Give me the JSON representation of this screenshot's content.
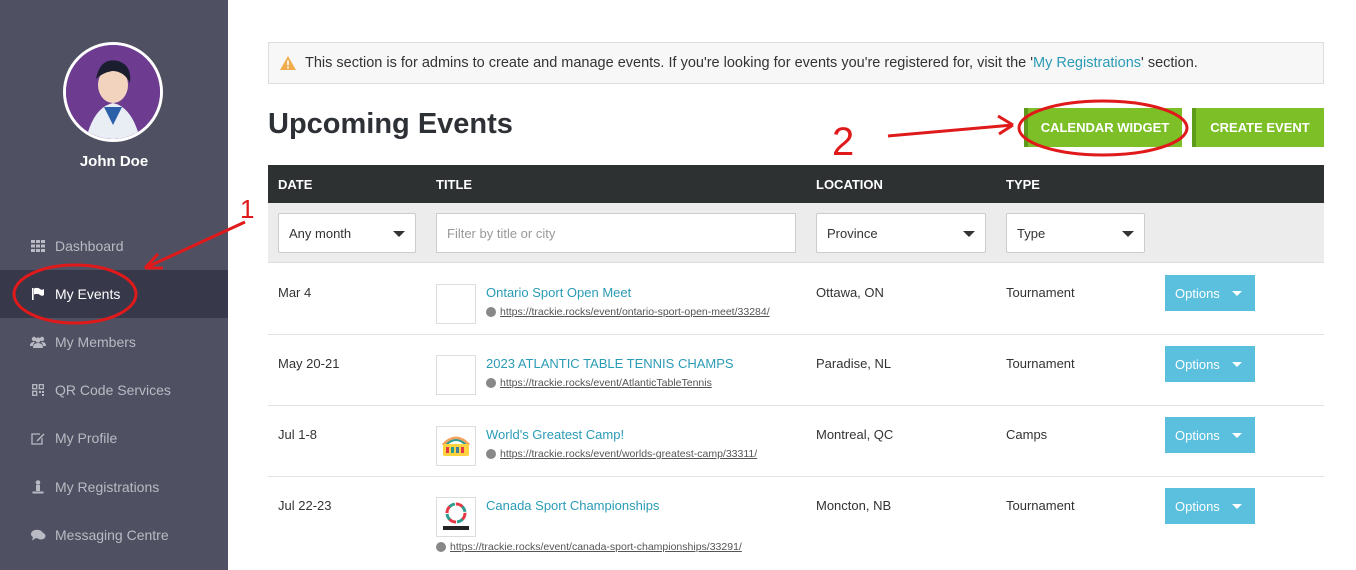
{
  "user": {
    "name": "John Doe"
  },
  "sidebar": {
    "items": [
      {
        "label": "Dashboard",
        "icon": "grid-icon"
      },
      {
        "label": "My Events",
        "icon": "flag-icon",
        "active": true
      },
      {
        "label": "My Members",
        "icon": "users-icon"
      },
      {
        "label": "QR Code Services",
        "icon": "qr-icon"
      },
      {
        "label": "My Profile",
        "icon": "edit-icon"
      },
      {
        "label": "My Registrations",
        "icon": "person-icon"
      },
      {
        "label": "Messaging Centre",
        "icon": "chat-icon"
      }
    ]
  },
  "alert": {
    "text_before": "This section is for admins to create and manage events. If you're looking for events you're registered for, visit the '",
    "link": "My Registrations",
    "text_after": "' section."
  },
  "page": {
    "title": "Upcoming Events",
    "calendar_widget_label": "CALENDAR WIDGET",
    "create_event_label": "CREATE EVENT"
  },
  "table": {
    "headers": {
      "date": "DATE",
      "title": "TITLE",
      "location": "LOCATION",
      "type": "TYPE"
    },
    "filters": {
      "month": "Any month",
      "title_placeholder": "Filter by title or city",
      "province": "Province",
      "type": "Type"
    },
    "options_label": "Options",
    "rows": [
      {
        "date": "Mar 4",
        "title": "Ontario Sport Open Meet",
        "url": "https://trackie.rocks/event/ontario-sport-open-meet/33284/",
        "location": "Ottawa, ON",
        "type": "Tournament"
      },
      {
        "date": "May 20-21",
        "title": "2023 ATLANTIC TABLE TENNIS CHAMPS",
        "url": "https://trackie.rocks/event/AtlanticTableTennis",
        "location": "Paradise, NL",
        "type": "Tournament"
      },
      {
        "date": "Jul 1-8",
        "title": "World's Greatest Camp!",
        "url": "https://trackie.rocks/event/worlds-greatest-camp/33311/",
        "location": "Montreal, QC",
        "type": "Camps"
      },
      {
        "date": "Jul 22-23",
        "title": "Canada Sport Championships",
        "url": "https://trackie.rocks/event/canada-sport-championships/33291/",
        "location": "Moncton, NB",
        "type": "Tournament"
      }
    ]
  },
  "annotations": {
    "step1": "1",
    "step2": "2"
  },
  "colors": {
    "sidebar": "#4f5162",
    "accent_green": "#7cbf27",
    "options_blue": "#5bc0de",
    "link": "#2a9bb5",
    "annotation_red": "#e0191b"
  }
}
